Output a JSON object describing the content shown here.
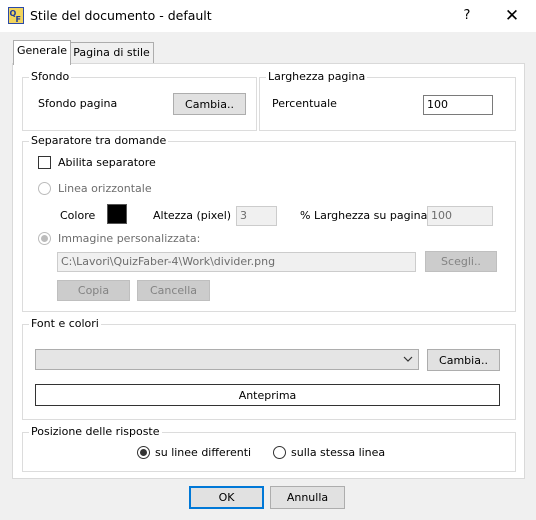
{
  "window": {
    "title": "Stile del documento - default",
    "help_label": "?",
    "close_label": "✕",
    "app_icon": "quizfaber-app-icon"
  },
  "tabs": [
    {
      "label": "Generale",
      "active": true
    },
    {
      "label": "Pagina di stile",
      "active": false
    }
  ],
  "sfondo": {
    "legend": "Sfondo",
    "label": "Sfondo pagina",
    "button": "Cambia.."
  },
  "larghezza": {
    "legend": "Larghezza pagina",
    "label": "Percentuale",
    "value": "100"
  },
  "separatore": {
    "legend": "Separatore tra domande",
    "enable_label": "Abilita separatore",
    "enable_checked": false,
    "horizontal_label": "Linea orizzontale",
    "color_label": "Colore",
    "color_value": "#000000",
    "height_label": "Altezza (pixel)",
    "height_value": "3",
    "width_label": "% Larghezza su pagina",
    "width_value": "100",
    "image_label": "Immagine personalizzata:",
    "image_path": "C:\\Lavori\\QuizFaber-4\\Work\\divider.png",
    "choose_button": "Scegli..",
    "copy_button": "Copia",
    "delete_button": "Cancella"
  },
  "font": {
    "legend": "Font e colori",
    "combo_value": "",
    "change_button": "Cambia..",
    "preview_button": "Anteprima"
  },
  "posizione": {
    "legend": "Posizione delle risposte",
    "option_different": "su linee differenti",
    "option_same": "sulla stessa linea",
    "selected": "different"
  },
  "footer": {
    "ok": "OK",
    "cancel": "Annulla"
  },
  "colors": {
    "accent": "#0078d7",
    "dialog_bg": "#f0f0f0",
    "panel_bg": "#ffffff"
  }
}
